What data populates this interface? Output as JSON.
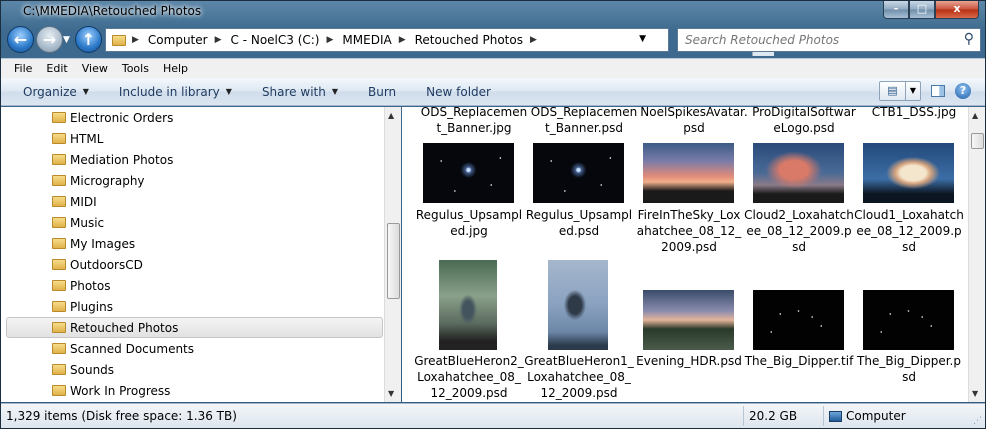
{
  "window": {
    "title": "C:\\MMEDIA\\Retouched Photos",
    "controls": [
      "-",
      "□",
      "x"
    ]
  },
  "nav": {
    "back": "←",
    "forward": "→",
    "dropdown": "▼",
    "up": "↑",
    "breadcrumbs": [
      "Computer",
      "C - NoelC3 (C:)",
      "MMEDIA",
      "Retouched Photos"
    ],
    "separator": "▶",
    "addr_dropdown": "▼",
    "refresh": "⟲",
    "search_placeholder": "Search Retouched Photos",
    "search_icon": "⚲"
  },
  "menu": [
    "File",
    "Edit",
    "View",
    "Tools",
    "Help"
  ],
  "commands": [
    {
      "label": "Organize",
      "dd": "▼"
    },
    {
      "label": "Include in library",
      "dd": "▼"
    },
    {
      "label": "Share with",
      "dd": "▼"
    },
    {
      "label": "Burn",
      "dd": ""
    },
    {
      "label": "New folder",
      "dd": ""
    }
  ],
  "cmd_right": {
    "view": "▤",
    "view_dd": "▼",
    "help": "?"
  },
  "tree": [
    {
      "label": "Electronic Orders",
      "selected": false
    },
    {
      "label": "HTML",
      "selected": false
    },
    {
      "label": "Mediation Photos",
      "selected": false
    },
    {
      "label": "Micrography",
      "selected": false
    },
    {
      "label": "MIDI",
      "selected": false
    },
    {
      "label": "Music",
      "selected": false
    },
    {
      "label": "My Images",
      "selected": false
    },
    {
      "label": "OutdoorsCD",
      "selected": false
    },
    {
      "label": "Photos",
      "selected": false
    },
    {
      "label": "Plugins",
      "selected": false
    },
    {
      "label": "Retouched Photos",
      "selected": true
    },
    {
      "label": "Scanned Documents",
      "selected": false
    },
    {
      "label": "Sounds",
      "selected": false
    },
    {
      "label": "Work In Progress",
      "selected": false
    }
  ],
  "files_top": [
    {
      "name": "ODS_Replacement_Banner.jpg"
    },
    {
      "name": "ODS_Replacement_Banner.psd"
    },
    {
      "name": "NoelSpikesAvatar.psd"
    },
    {
      "name": "ProDigitalSoftwareLogo.psd"
    },
    {
      "name": "CTB1_DSS.jpg"
    }
  ],
  "files_row2": [
    {
      "name": "Regulus_Upsampled.jpg",
      "style": "stars"
    },
    {
      "name": "Regulus_Upsampled.psd",
      "style": "stars"
    },
    {
      "name": "FireInTheSky_Loxahatchee_08_12_2009.psd",
      "style": "sky1"
    },
    {
      "name": "Cloud2_Loxahatchee_08_12_2009.psd",
      "style": "sky2"
    },
    {
      "name": "Cloud1_Loxahatchee_08_12_2009.psd",
      "style": "sky3"
    }
  ],
  "files_row3": [
    {
      "name": "GreatBlueHeron2_Loxahatchee_08_12_2009.psd",
      "style": "heron1"
    },
    {
      "name": "GreatBlueHeron1_Loxahatchee_08_12_2009.psd",
      "style": "heron2"
    },
    {
      "name": "Evening_HDR.psd",
      "style": "evening"
    },
    {
      "name": "The_Big_Dipper.tif",
      "style": "dipper"
    },
    {
      "name": "The_Big_Dipper.psd",
      "style": "dipper"
    }
  ],
  "status": {
    "items": "1,329 items (Disk free space: 1.36 TB)",
    "size": "20.2 GB",
    "location": "Computer"
  }
}
